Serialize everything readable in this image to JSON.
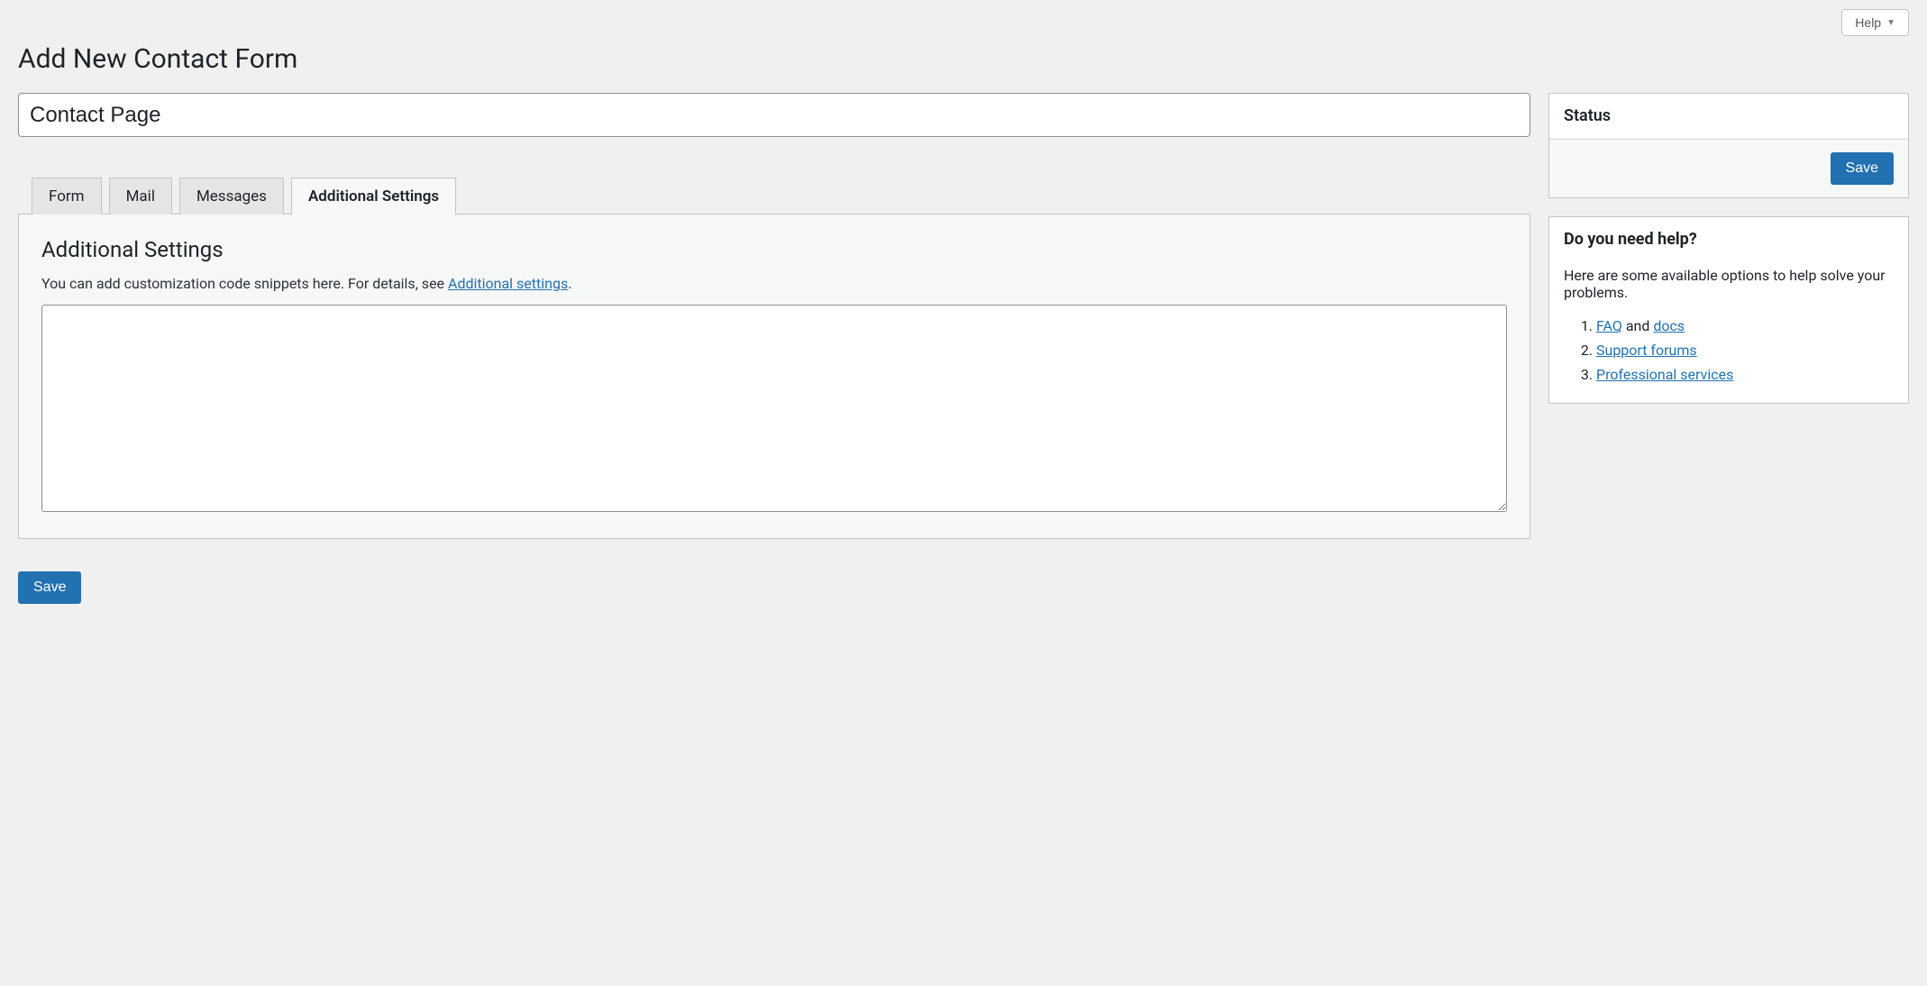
{
  "topbar": {
    "help_label": "Help"
  },
  "page": {
    "title": "Add New Contact Form",
    "form_title_value": "Contact Page"
  },
  "tabs": {
    "form": "Form",
    "mail": "Mail",
    "messages": "Messages",
    "additional_settings": "Additional Settings"
  },
  "panel": {
    "heading": "Additional Settings",
    "desc_prefix": "You can add customization code snippets here. For details, see ",
    "desc_link": "Additional settings",
    "desc_suffix": ".",
    "textarea_value": ""
  },
  "buttons": {
    "save": "Save"
  },
  "sidebar": {
    "status": {
      "title": "Status"
    },
    "help": {
      "title": "Do you need help?",
      "intro": "Here are some available options to help solve your problems.",
      "items": {
        "faq": "FAQ",
        "and": " and ",
        "docs": "docs",
        "support_forums": "Support forums",
        "professional_services": "Professional services"
      }
    }
  }
}
